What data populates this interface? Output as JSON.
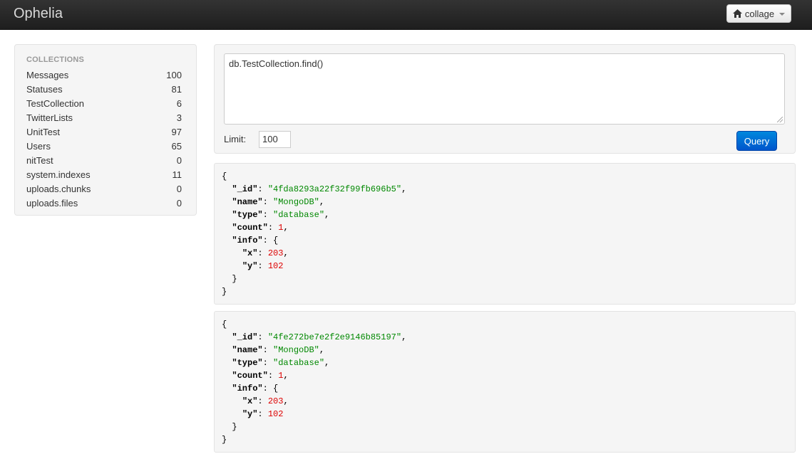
{
  "app": {
    "title": "Ophelia"
  },
  "database_menu": {
    "label": "collage",
    "icon": "home-icon"
  },
  "sidebar": {
    "header": "COLLECTIONS",
    "items": [
      {
        "name": "Messages",
        "count": "100"
      },
      {
        "name": "Statuses",
        "count": "81"
      },
      {
        "name": "TestCollection",
        "count": "6"
      },
      {
        "name": "TwitterLists",
        "count": "3"
      },
      {
        "name": "UnitTest",
        "count": "97"
      },
      {
        "name": "Users",
        "count": "65"
      },
      {
        "name": "nitTest",
        "count": "0"
      },
      {
        "name": "system.indexes",
        "count": "11"
      },
      {
        "name": "uploads.chunks",
        "count": "0"
      },
      {
        "name": "uploads.files",
        "count": "0"
      }
    ]
  },
  "query": {
    "text": "db.TestCollection.find()",
    "limit_label": "Limit:",
    "limit_value": "100",
    "button_label": "Query"
  },
  "colors": {
    "accent": "#0066dd",
    "string": "#008800",
    "number": "#dd0000"
  },
  "results": [
    {
      "_id": "4fda8293a22f32f99fb696b5",
      "name": "MongoDB",
      "type": "database",
      "count": "1",
      "info": {
        "x": "203",
        "y": "102"
      }
    },
    {
      "_id": "4fe272be7e2f2e9146b85197",
      "name": "MongoDB",
      "type": "database",
      "count": "1",
      "info": {
        "x": "203",
        "y": "102"
      }
    }
  ]
}
